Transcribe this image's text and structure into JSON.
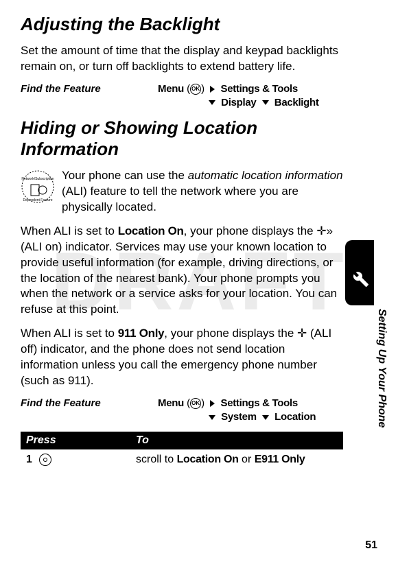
{
  "watermark": "DRAFT",
  "section1": {
    "heading": "Adjusting the Backlight",
    "intro": "Set the amount of time that the display and keypad backlights remain on, or turn off backlights to extend battery life.",
    "findFeature": {
      "label": "Find the Feature",
      "menu": "Menu",
      "ok": "OK",
      "path1a": "Settings & Tools",
      "path2a": "Display",
      "path2b": "Backlight"
    }
  },
  "section2": {
    "heading": "Hiding or Showing Location Information",
    "para1_pre": "Your phone can use the ",
    "para1_em": "automatic location information",
    "para1_post": " (ALI) feature to tell the network where you are physically located.",
    "para2_pre": "When ALI is set to ",
    "para2_bold1": "Location On",
    "para2_mid1": ", your phone displays the ",
    "para2_mid2": " (ALI on) indicator. Services may use your known location to provide useful information (for example, driving directions, or the location of the nearest bank). Your phone prompts you when the network or a service asks for your location. You can refuse at this point.",
    "para3_pre": "When ALI is set to ",
    "para3_bold1": "911 Only",
    "para3_mid1": ", your phone displays the ",
    "para3_mid2": " (ALI off) indicator, and the phone does not send location information unless you call the emergency phone number (such as 911).",
    "findFeature": {
      "label": "Find the Feature",
      "menu": "Menu",
      "ok": "OK",
      "path1a": "Settings & Tools",
      "path2a": "System",
      "path2b": "Location"
    }
  },
  "table": {
    "header": {
      "press": "Press",
      "to": "To"
    },
    "row1": {
      "num": "1",
      "action_pre": "scroll to ",
      "action_bold1": "Location On",
      "action_mid": " or ",
      "action_bold2": "E911 Only"
    }
  },
  "sideLabel": "Setting Up Your Phone",
  "pageNumber": "51"
}
